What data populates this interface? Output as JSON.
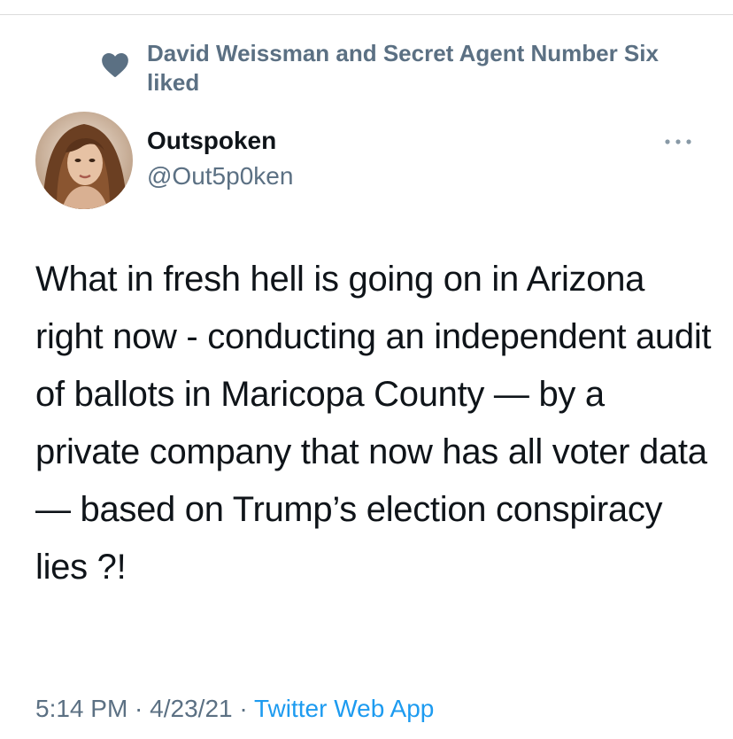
{
  "social_context": {
    "icon": "heart-icon",
    "text": "David Weissman and Secret Agent Number Six liked"
  },
  "author": {
    "display_name": "Outspoken",
    "handle": "@Out5p0ken"
  },
  "tweet": {
    "text": "What in fresh hell is going on in Arizona right now - conducting an independent audit of ballots in Maricopa County — by a private company that now has all voter data — based on Trump’s election conspiracy lies ?!",
    "time": "5:14 PM",
    "separator": " · ",
    "date": "4/23/21",
    "source": "Twitter Web App"
  },
  "colors": {
    "secondary_text": "#5b7083",
    "link": "#1d9bf0",
    "primary_text": "#0f1419"
  }
}
